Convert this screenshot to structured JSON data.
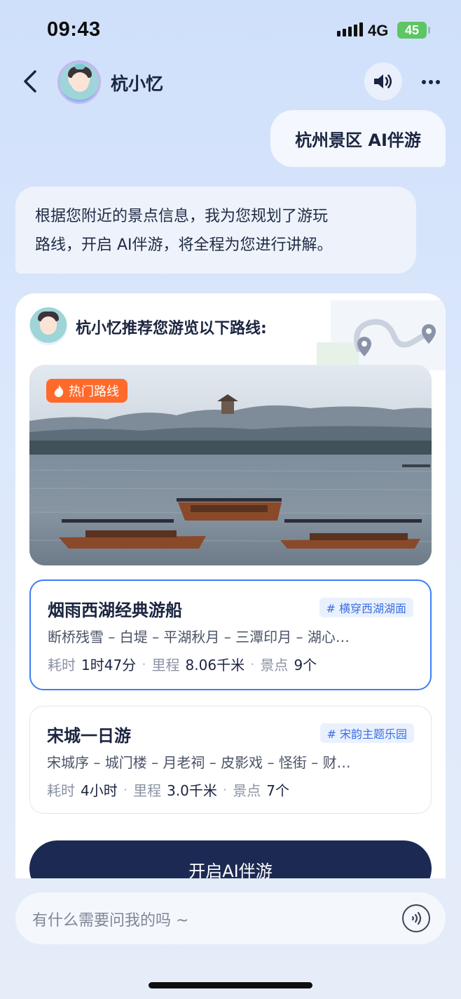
{
  "status": {
    "time": "09:43",
    "network": "4G",
    "battery": "45"
  },
  "nav": {
    "title": "杭小忆"
  },
  "chat": {
    "user_message": "杭州景区 AI伴游",
    "ai_message_line1": "根据您附近的景点信息，我为您规划了游玩",
    "ai_message_line2": "路线，开启 AI伴游，将全程为您进行讲解。"
  },
  "card": {
    "title": "杭小忆推荐您游览以下路线:",
    "hot_badge": "热门路线",
    "routes": [
      {
        "name": "烟雨西湖经典游船",
        "tag": "# 横穿西湖湖面",
        "stops": "断桥残雪 – 白堤 – 平湖秋月 – 三潭印月 – 湖心…",
        "time_label": "耗时",
        "time_value": "1时47分",
        "distance_label": "里程",
        "distance_value": "8.06千米",
        "spots_label": "景点",
        "spots_value": "9个",
        "selected": true
      },
      {
        "name": "宋城一日游",
        "tag": "# 宋韵主题乐园",
        "stops": "宋城序 – 城门楼 – 月老祠 – 皮影戏 – 怪街 – 财…",
        "time_label": "耗时",
        "time_value": "4小时",
        "distance_label": "里程",
        "distance_value": "3.0千米",
        "spots_label": "景点",
        "spots_value": "7个",
        "selected": false
      }
    ],
    "start_button": "开启AI伴游"
  },
  "input": {
    "placeholder": "有什么需要问我的吗 ~"
  },
  "icons": {
    "back": "chevron-left-icon",
    "speaker": "speaker-icon",
    "more": "more-icon",
    "fire": "fire-icon",
    "voice": "voice-wave-icon",
    "map_pin": "map-pin-icon"
  },
  "colors": {
    "accent": "#3f7df3",
    "primary_button": "#1c2a53",
    "hot_badge": "#ff6a2b",
    "battery": "#5ec563"
  }
}
